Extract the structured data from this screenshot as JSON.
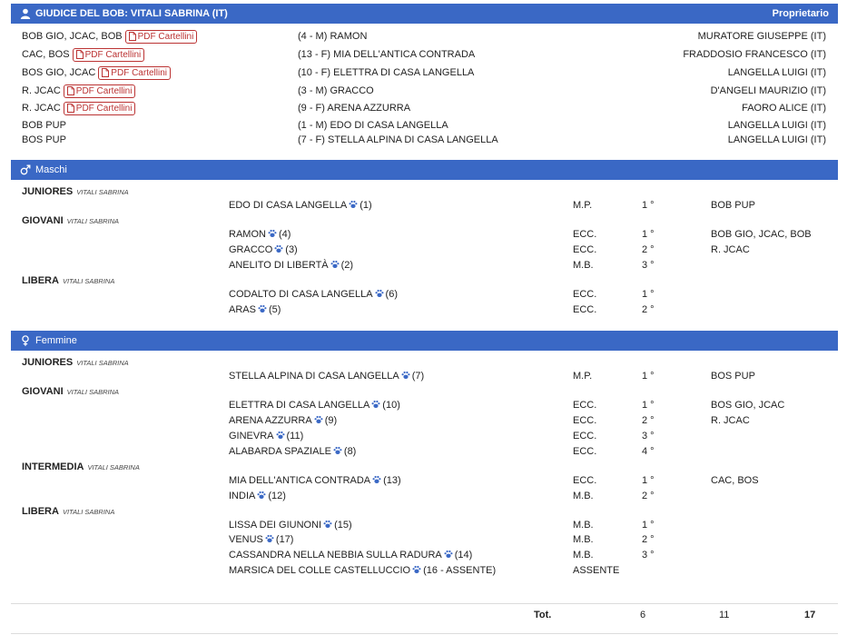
{
  "colors": {
    "header_bg": "#3a68c5",
    "pdf_border": "#b33333"
  },
  "judge_header": {
    "title": "GIUDICE DEL BOB: VITALI SABRINA (IT)",
    "owner_label": "Proprietario"
  },
  "pdf_label": "PDF Cartellini",
  "bob_rows": [
    {
      "awards": "BOB GIO, JCAC, BOB",
      "has_pdf": true,
      "dog": "(4 - M) RAMON",
      "owner": "MURATORE GIUSEPPE (IT)"
    },
    {
      "awards": "CAC, BOS",
      "has_pdf": true,
      "dog": "(13 - F) MIA DELL'ANTICA CONTRADA",
      "owner": "FRADDOSIO FRANCESCO (IT)"
    },
    {
      "awards": "BOS GIO, JCAC",
      "has_pdf": true,
      "dog": "(10 - F) ELETTRA DI CASA LANGELLA",
      "owner": "LANGELLA LUIGI (IT)"
    },
    {
      "awards": "R. JCAC",
      "has_pdf": true,
      "dog": "(3 - M) GRACCO",
      "owner": "D'ANGELI MAURIZIO (IT)"
    },
    {
      "awards": "R. JCAC",
      "has_pdf": true,
      "dog": "(9 - F) ARENA AZZURRA",
      "owner": "FAORO ALICE (IT)"
    },
    {
      "awards": "BOB PUP",
      "has_pdf": false,
      "dog": "(1 - M) EDO DI CASA LANGELLA",
      "owner": "LANGELLA LUIGI (IT)"
    },
    {
      "awards": "BOS PUP",
      "has_pdf": false,
      "dog": "(7 - F) STELLA ALPINA DI CASA LANGELLA",
      "owner": "LANGELLA LUIGI (IT)"
    }
  ],
  "sections": [
    {
      "title": "Maschi",
      "icon": "male-icon",
      "classes": [
        {
          "name": "JUNIORES",
          "judge": "VITALI SABRINA",
          "entries": [
            {
              "dog": "EDO DI CASA LANGELLA",
              "num": "(1)",
              "grade": "M.P.",
              "place": "1 °",
              "award": "BOB PUP"
            }
          ]
        },
        {
          "name": "GIOVANI",
          "judge": "VITALI SABRINA",
          "entries": [
            {
              "dog": "RAMON",
              "num": "(4)",
              "grade": "ECC.",
              "place": "1 °",
              "award": "BOB GIO, JCAC, BOB"
            },
            {
              "dog": "GRACCO",
              "num": "(3)",
              "grade": "ECC.",
              "place": "2 °",
              "award": "R. JCAC"
            },
            {
              "dog": "ANELITO DI LIBERTÀ",
              "num": "(2)",
              "grade": "M.B.",
              "place": "3 °",
              "award": ""
            }
          ]
        },
        {
          "name": "LIBERA",
          "judge": "VITALI SABRINA",
          "entries": [
            {
              "dog": "CODALTO DI CASA LANGELLA",
              "num": "(6)",
              "grade": "ECC.",
              "place": "1 °",
              "award": ""
            },
            {
              "dog": "ARAS",
              "num": "(5)",
              "grade": "ECC.",
              "place": "2 °",
              "award": ""
            }
          ]
        }
      ]
    },
    {
      "title": "Femmine",
      "icon": "female-icon",
      "classes": [
        {
          "name": "JUNIORES",
          "judge": "VITALI SABRINA",
          "entries": [
            {
              "dog": "STELLA ALPINA DI CASA LANGELLA",
              "num": "(7)",
              "grade": "M.P.",
              "place": "1 °",
              "award": "BOS PUP"
            }
          ]
        },
        {
          "name": "GIOVANI",
          "judge": "VITALI SABRINA",
          "entries": [
            {
              "dog": "ELETTRA DI CASA LANGELLA",
              "num": "(10)",
              "grade": "ECC.",
              "place": "1 °",
              "award": "BOS GIO, JCAC"
            },
            {
              "dog": "ARENA AZZURRA",
              "num": "(9)",
              "grade": "ECC.",
              "place": "2 °",
              "award": "R. JCAC"
            },
            {
              "dog": "GINEVRA",
              "num": "(11)",
              "grade": "ECC.",
              "place": "3 °",
              "award": ""
            },
            {
              "dog": "ALABARDA SPAZIALE",
              "num": "(8)",
              "grade": "ECC.",
              "place": "4 °",
              "award": ""
            }
          ]
        },
        {
          "name": "INTERMEDIA",
          "judge": "VITALI SABRINA",
          "entries": [
            {
              "dog": "MIA DELL'ANTICA CONTRADA",
              "num": "(13)",
              "grade": "ECC.",
              "place": "1 °",
              "award": "CAC, BOS"
            },
            {
              "dog": "INDIA",
              "num": "(12)",
              "grade": "M.B.",
              "place": "2 °",
              "award": ""
            }
          ]
        },
        {
          "name": "LIBERA",
          "judge": "VITALI SABRINA",
          "entries": [
            {
              "dog": "LISSA DEI GIUNONI",
              "num": "(15)",
              "grade": "M.B.",
              "place": "1 °",
              "award": ""
            },
            {
              "dog": "VENUS",
              "num": "(17)",
              "grade": "M.B.",
              "place": "2 °",
              "award": ""
            },
            {
              "dog": "CASSANDRA NELLA NEBBIA SULLA RADURA",
              "num": "(14)",
              "grade": "M.B.",
              "place": "3 °",
              "award": ""
            },
            {
              "dog": "MARSICA DEL COLLE CASTELLUCCIO",
              "num": "(16 - ASSENTE)",
              "grade": "ASSENTE",
              "place": "",
              "award": ""
            }
          ]
        }
      ]
    }
  ],
  "totals": {
    "label": "Tot.",
    "values": [
      "6",
      "11",
      "17"
    ]
  }
}
